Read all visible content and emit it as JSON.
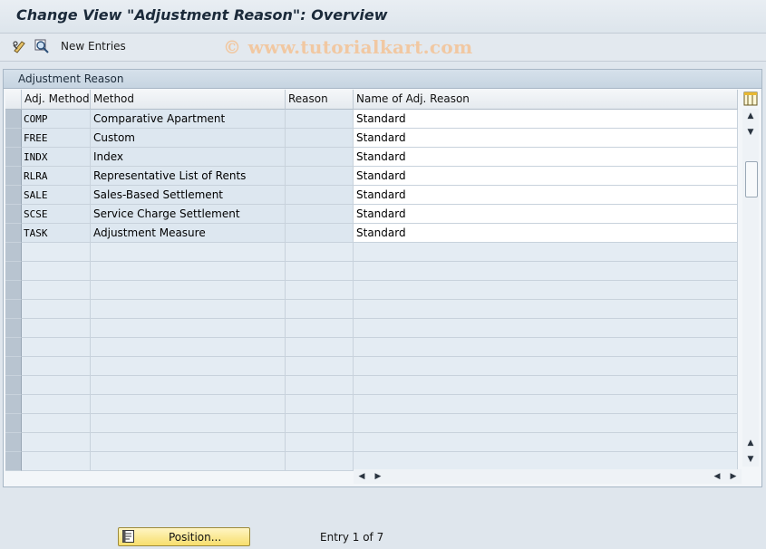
{
  "window": {
    "title": "Change View \"Adjustment Reason\": Overview"
  },
  "toolbar": {
    "new_entries_label": "New Entries",
    "watermark": "© www.tutorialkart.com"
  },
  "panel": {
    "title": "Adjustment Reason"
  },
  "table": {
    "columns": [
      "Adj. Method",
      "Method",
      "Reason",
      "Name of Adj. Reason"
    ],
    "rows": [
      {
        "adj_method": "COMP",
        "method": "Comparative Apartment",
        "reason": "",
        "name": "Standard"
      },
      {
        "adj_method": "FREE",
        "method": "Custom",
        "reason": "",
        "name": "Standard"
      },
      {
        "adj_method": "INDX",
        "method": "Index",
        "reason": "",
        "name": "Standard"
      },
      {
        "adj_method": "RLRA",
        "method": "Representative List of Rents",
        "reason": "",
        "name": "Standard"
      },
      {
        "adj_method": "SALE",
        "method": "Sales-Based Settlement",
        "reason": "",
        "name": "Standard"
      },
      {
        "adj_method": "SCSE",
        "method": "Service Charge Settlement",
        "reason": "",
        "name": "Standard"
      },
      {
        "adj_method": "TASK",
        "method": "Adjustment Measure",
        "reason": "",
        "name": "Standard"
      }
    ]
  },
  "footer": {
    "position_label": "Position...",
    "entry_text": "Entry 1 of 7"
  }
}
